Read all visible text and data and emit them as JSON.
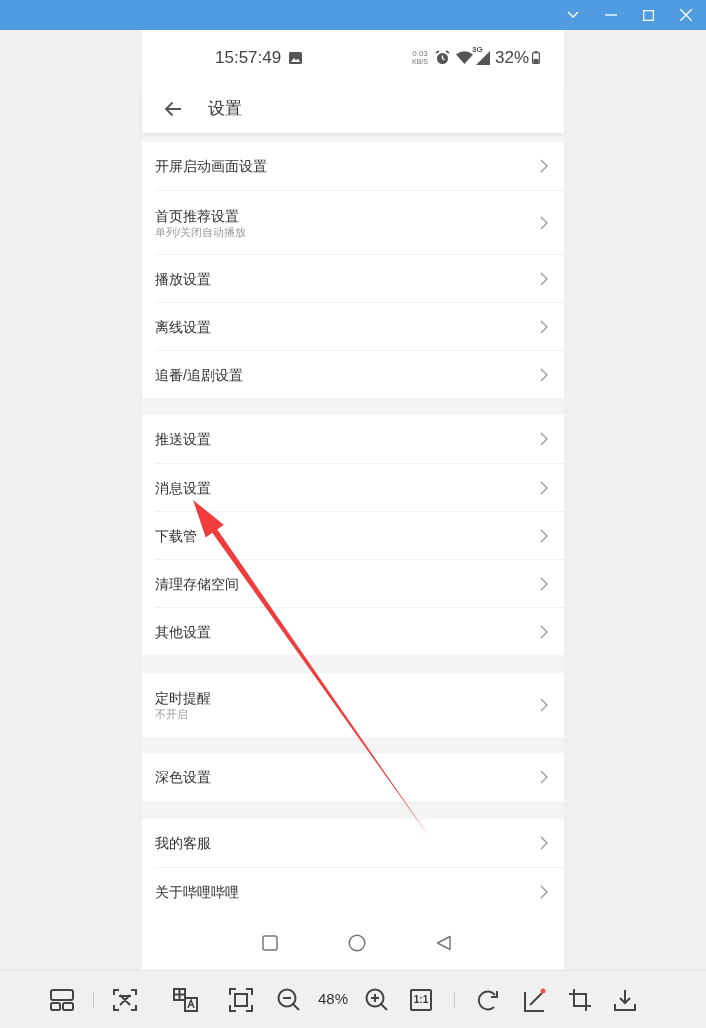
{
  "status_bar": {
    "time": "15:57:49",
    "net_speed": "0.03",
    "net_unit": "KB/S",
    "network": "3G",
    "battery": "32%"
  },
  "header": {
    "title": "设置"
  },
  "groups": [
    {
      "items": [
        {
          "title": "开屏启动画面设置"
        },
        {
          "title": "首页推荐设置",
          "subtitle": "单列/关闭自动播放"
        },
        {
          "title": "播放设置"
        },
        {
          "title": "离线设置"
        },
        {
          "title": "追番/追剧设置"
        }
      ]
    },
    {
      "items": [
        {
          "title": "推送设置"
        },
        {
          "title": "消息设置"
        },
        {
          "title": "下载管"
        },
        {
          "title": "清理存储空间"
        },
        {
          "title": "其他设置"
        }
      ]
    },
    {
      "items": [
        {
          "title": "定时提醒",
          "subtitle": "不开启"
        }
      ]
    },
    {
      "items": [
        {
          "title": "深色设置"
        }
      ]
    },
    {
      "items": [
        {
          "title": "我的客服"
        },
        {
          "title": "关于哔哩哔哩"
        }
      ]
    }
  ],
  "toolbar": {
    "zoom": "48%",
    "actual_size": "1:1"
  }
}
